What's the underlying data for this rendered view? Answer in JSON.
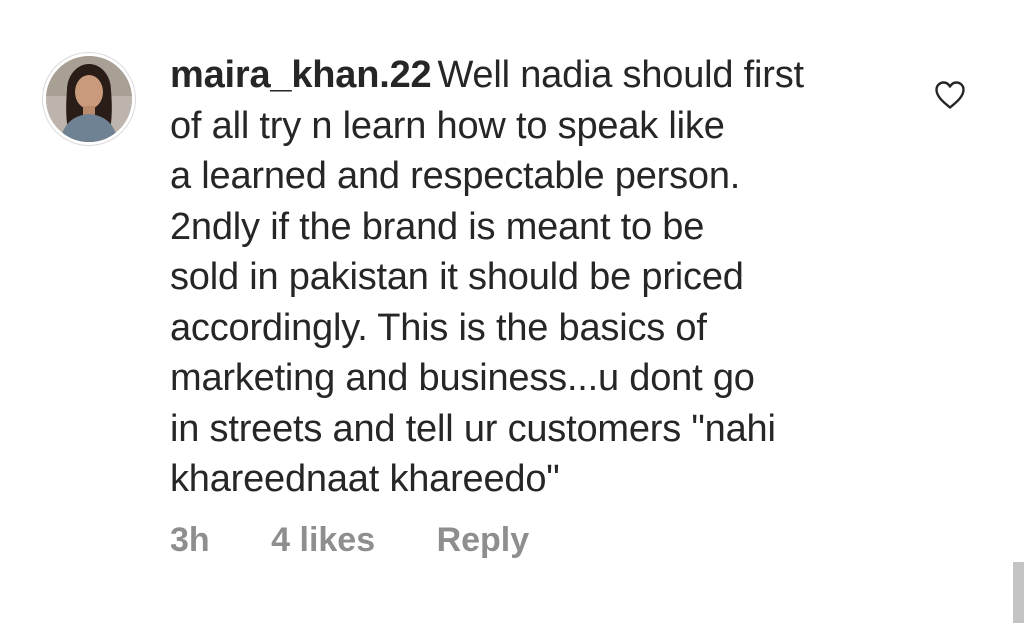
{
  "comment": {
    "username": "maira_khan.22",
    "lines": [
      "Well nadia should first",
      "of all try n learn how to speak like",
      "a learned and respectable person.",
      "2ndly if the brand is meant to be",
      "sold in pakistan it should be priced",
      "accordingly. This is the basics of",
      "marketing and business...u dont go",
      "in streets and tell ur customers \"nahi",
      "khareednaat khareedo\""
    ],
    "time": "3h",
    "likes": "4 likes",
    "reply_label": "Reply"
  },
  "icons": {
    "like": "heart-outline-icon",
    "avatar": "user-avatar"
  },
  "colors": {
    "text": "#262626",
    "meta": "#8e8e8e",
    "avatar_border": "#dbdbdb",
    "scrollbar": "#c4c4c4"
  }
}
